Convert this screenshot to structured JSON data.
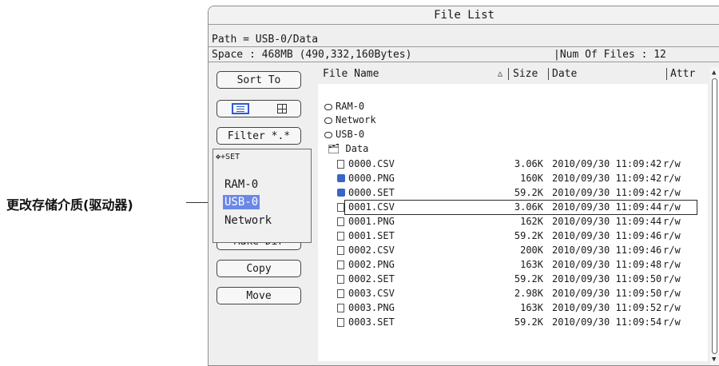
{
  "callout": "更改存储介质(驱动器)",
  "window": {
    "title": "File List",
    "path": "Path = USB-0/Data",
    "space": "Space : 468MB (490,332,160Bytes)",
    "num_files": "|Num Of Files : 12"
  },
  "buttons": {
    "sort": "Sort To",
    "filter": "Filter  *.*",
    "make_dir": "Make Dir",
    "copy": "Copy",
    "move": "Move"
  },
  "popup": {
    "hint_icon": "move-cursor-set-icon",
    "hint": "+SET",
    "options": [
      "RAM-0",
      "USB-0",
      "Network"
    ],
    "selected": "USB-0"
  },
  "columns": {
    "name": "File Name",
    "sort_mark": "△",
    "size": "Size",
    "date": "Date",
    "attr": "Attr"
  },
  "drives": [
    "RAM-0",
    "Network",
    "USB-0"
  ],
  "folder": "Data",
  "files": [
    {
      "name": "0000.CSV",
      "size": "3.06K",
      "date": "2010/09/30 11:09:42",
      "attr": "r/w",
      "icon": "document-icon"
    },
    {
      "name": "0000.PNG",
      "size": "160K",
      "date": "2010/09/30 11:09:42",
      "attr": "r/w",
      "icon": "image-icon"
    },
    {
      "name": "0000.SET",
      "size": "59.2K",
      "date": "2010/09/30 11:09:42",
      "attr": "r/w",
      "icon": "image-icon"
    },
    {
      "name": "0001.CSV",
      "size": "3.06K",
      "date": "2010/09/30 11:09:44",
      "attr": "r/w",
      "icon": "document-icon"
    },
    {
      "name": "0001.PNG",
      "size": "162K",
      "date": "2010/09/30 11:09:44",
      "attr": "r/w",
      "icon": "document-icon"
    },
    {
      "name": "0001.SET",
      "size": "59.2K",
      "date": "2010/09/30 11:09:46",
      "attr": "r/w",
      "icon": "document-icon"
    },
    {
      "name": "0002.CSV",
      "size": "200K",
      "date": "2010/09/30 11:09:46",
      "attr": "r/w",
      "icon": "document-icon"
    },
    {
      "name": "0002.PNG",
      "size": "163K",
      "date": "2010/09/30 11:09:48",
      "attr": "r/w",
      "icon": "document-icon"
    },
    {
      "name": "0002.SET",
      "size": "59.2K",
      "date": "2010/09/30 11:09:50",
      "attr": "r/w",
      "icon": "document-icon"
    },
    {
      "name": "0003.CSV",
      "size": "2.98K",
      "date": "2010/09/30 11:09:50",
      "attr": "r/w",
      "icon": "document-icon"
    },
    {
      "name": "0003.PNG",
      "size": "163K",
      "date": "2010/09/30 11:09:52",
      "attr": "r/w",
      "icon": "document-icon"
    },
    {
      "name": "0003.SET",
      "size": "59.2K",
      "date": "2010/09/30 11:09:54",
      "attr": "r/w",
      "icon": "document-icon"
    }
  ],
  "selected_file": "0001.CSV",
  "colors": {
    "highlight": "#6b88e6",
    "list_icon": "#2f5ad8"
  }
}
